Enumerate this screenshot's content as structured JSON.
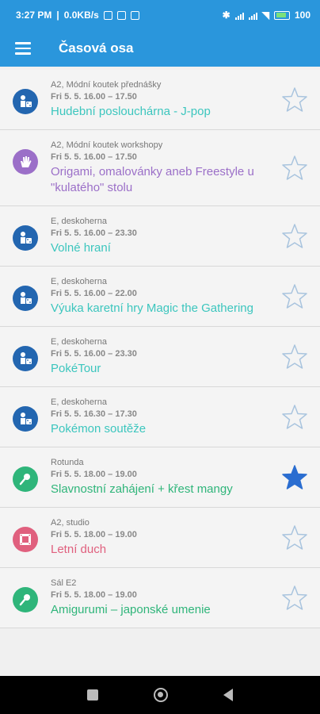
{
  "status": {
    "time": "3:27 PM",
    "speed": "0.0KB/s",
    "battery": "100"
  },
  "appbar": {
    "title": "Časová osa"
  },
  "colors": {
    "primary": "#2a96dc",
    "teal": "#3cc6be",
    "purple": "#9b6fc8",
    "green": "#2fb57a",
    "pink": "#e0607e",
    "blue": "#2366b0",
    "star_outline": "#a9c4de",
    "star_filled": "#2a6dd0"
  },
  "events": [
    {
      "location": "A2, Módní koutek přednášky",
      "time": "Fri 5. 5. 16.00 – 17.50",
      "title": "Hudební poslouchárna - J-pop",
      "icon": "board-game-icon",
      "favorite": false
    },
    {
      "location": "A2, Módní koutek workshopy",
      "time": "Fri 5. 5. 16.00 – 17.50",
      "title": "Origami, omalovánky aneb Freestyle u \"kulatého\" stolu",
      "icon": "hand-icon",
      "favorite": false
    },
    {
      "location": "E, deskoherna",
      "time": "Fri 5. 5. 16.00 – 23.30",
      "title": "Volné hraní",
      "icon": "board-game-icon",
      "favorite": false
    },
    {
      "location": "E, deskoherna",
      "time": "Fri 5. 5. 16.00 – 22.00",
      "title": "Výuka karetní hry Magic the Gathering",
      "icon": "board-game-icon",
      "favorite": false
    },
    {
      "location": "E, deskoherna",
      "time": "Fri 5. 5. 16.00 – 23.30",
      "title": "PokéTour",
      "icon": "board-game-icon",
      "favorite": false
    },
    {
      "location": "E, deskoherna",
      "time": "Fri 5. 5. 16.30 – 17.30",
      "title": "Pokémon soutěže",
      "icon": "board-game-icon",
      "favorite": false
    },
    {
      "location": "Rotunda",
      "time": "Fri 5. 5. 18.00 – 19.00",
      "title": "Slavnostní zahájení + křest mangy",
      "icon": "microphone-icon",
      "favorite": true
    },
    {
      "location": "A2, studio",
      "time": "Fri 5. 5. 18.00 – 19.00",
      "title": "Letní duch",
      "icon": "film-icon",
      "favorite": false
    },
    {
      "location": "Sál E2",
      "time": "Fri 5. 5. 18.00 – 19.00",
      "title": "Amigurumi – japonské umenie",
      "icon": "microphone-icon",
      "favorite": false
    }
  ]
}
